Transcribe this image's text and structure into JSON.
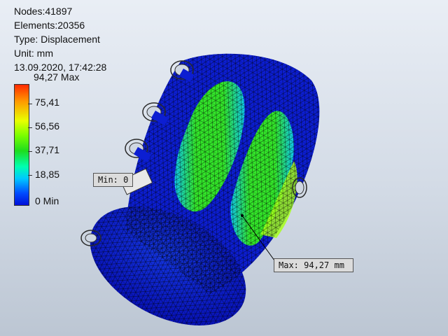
{
  "info": {
    "nodes": "Nodes:41897",
    "elements": "Elements:20356",
    "type": "Type: Displacement",
    "unit": "Unit: mm",
    "timestamp": "13.09.2020, 17:42:28"
  },
  "legend": {
    "max_label": "94,27 Max",
    "v1": "75,41",
    "v2": "56,56",
    "v3": "37,71",
    "v4": "18,85",
    "min_label": "0 Min"
  },
  "callouts": {
    "min": "Min: 0",
    "max": "Max: 94,27 mm"
  },
  "colors": {
    "mesh_low": "#0a1ed2",
    "mesh_mid": "#2ee62e",
    "mesh_cyan": "#10c8e8",
    "mesh_high": "#e6ff00"
  }
}
